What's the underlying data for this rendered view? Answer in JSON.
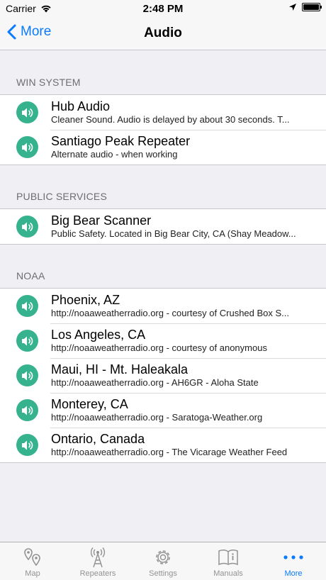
{
  "status_bar": {
    "carrier": "Carrier",
    "time": "2:48 PM"
  },
  "nav": {
    "back_label": "More",
    "title": "Audio"
  },
  "sections": [
    {
      "header": "WIN SYSTEM",
      "rows": [
        {
          "title": "Hub Audio",
          "subtitle": "Cleaner Sound. Audio is delayed by about 30 seconds. T..."
        },
        {
          "title": "Santiago Peak Repeater",
          "subtitle": "Alternate audio - when working"
        }
      ]
    },
    {
      "header": "PUBLIC SERVICES",
      "rows": [
        {
          "title": "Big Bear Scanner",
          "subtitle": "Public Safety. Located in Big Bear City, CA (Shay Meadow..."
        }
      ]
    },
    {
      "header": "NOAA",
      "rows": [
        {
          "title": "Phoenix, AZ",
          "subtitle": "http://noaaweatherradio.org - courtesy of Crushed Box S..."
        },
        {
          "title": "Los Angeles, CA",
          "subtitle": "http://noaaweatherradio.org - courtesy of anonymous"
        },
        {
          "title": "Maui, HI - Mt. Haleakala",
          "subtitle": "http://noaaweatherradio.org - AH6GR - Aloha State"
        },
        {
          "title": "Monterey, CA",
          "subtitle": "http://noaaweatherradio.org - Saratoga-Weather.org"
        },
        {
          "title": "Ontario, Canada",
          "subtitle": "http://noaaweatherradio.org - The Vicarage Weather Feed"
        }
      ]
    }
  ],
  "tabs": [
    {
      "label": "Map",
      "icon": "map-pins-icon",
      "active": false
    },
    {
      "label": "Repeaters",
      "icon": "antenna-icon",
      "active": false
    },
    {
      "label": "Settings",
      "icon": "gear-icon",
      "active": false
    },
    {
      "label": "Manuals",
      "icon": "book-icon",
      "active": false
    },
    {
      "label": "More",
      "icon": "more-dots-icon",
      "active": true
    }
  ],
  "colors": {
    "accent": "#0a7aff",
    "speaker": "#36b38e"
  }
}
